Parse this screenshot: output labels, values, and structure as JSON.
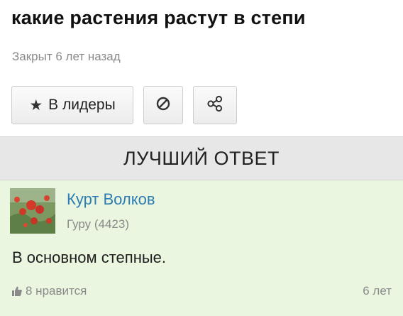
{
  "question": {
    "title": "какие растения растут в степи",
    "status": "Закрыт 6 лет назад"
  },
  "toolbar": {
    "leader_label": "В лидеры",
    "leader_icon": "star-icon",
    "block_icon": "block-icon",
    "share_icon": "share-icon"
  },
  "best_answer": {
    "header": "ЛУЧШИЙ ОТВЕТ",
    "author_name": "Курт Волков",
    "author_rank": "Гуру (4423)",
    "text": "В основном степные.",
    "likes": "8 нравится",
    "likes_icon": "thumbs-up-icon",
    "age": "6 лет"
  },
  "colors": {
    "answer_background": "#eaf6e0",
    "author_link": "#2c7db3",
    "header_background": "#e7e7e7"
  }
}
